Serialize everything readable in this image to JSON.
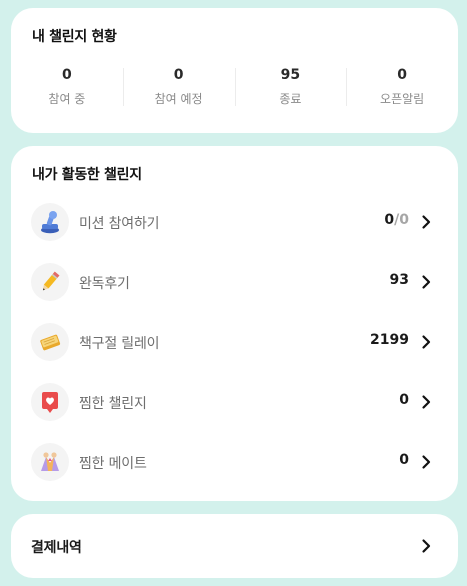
{
  "status_card": {
    "title": "내 챌린지 현황",
    "stats": [
      {
        "value": "0",
        "label": "참여 중"
      },
      {
        "value": "0",
        "label": "참여 예정"
      },
      {
        "value": "95",
        "label": "종료"
      },
      {
        "value": "0",
        "label": "오픈알림"
      }
    ]
  },
  "activity_card": {
    "title": "내가 활동한 챌린지",
    "items": [
      {
        "icon": "stamp-icon",
        "label": "미션 참여하기",
        "value": "0",
        "value_suffix": "/0"
      },
      {
        "icon": "pencil-icon",
        "label": "완독후기",
        "value": "93",
        "value_suffix": ""
      },
      {
        "icon": "book-icon",
        "label": "책구절 릴레이",
        "value": "2199",
        "value_suffix": ""
      },
      {
        "icon": "heart-tag-icon",
        "label": "찜한 챌린지",
        "value": "0",
        "value_suffix": ""
      },
      {
        "icon": "people-icon",
        "label": "찜한 메이트",
        "value": "0",
        "value_suffix": ""
      }
    ]
  },
  "payment_card": {
    "label": "결제내역"
  }
}
